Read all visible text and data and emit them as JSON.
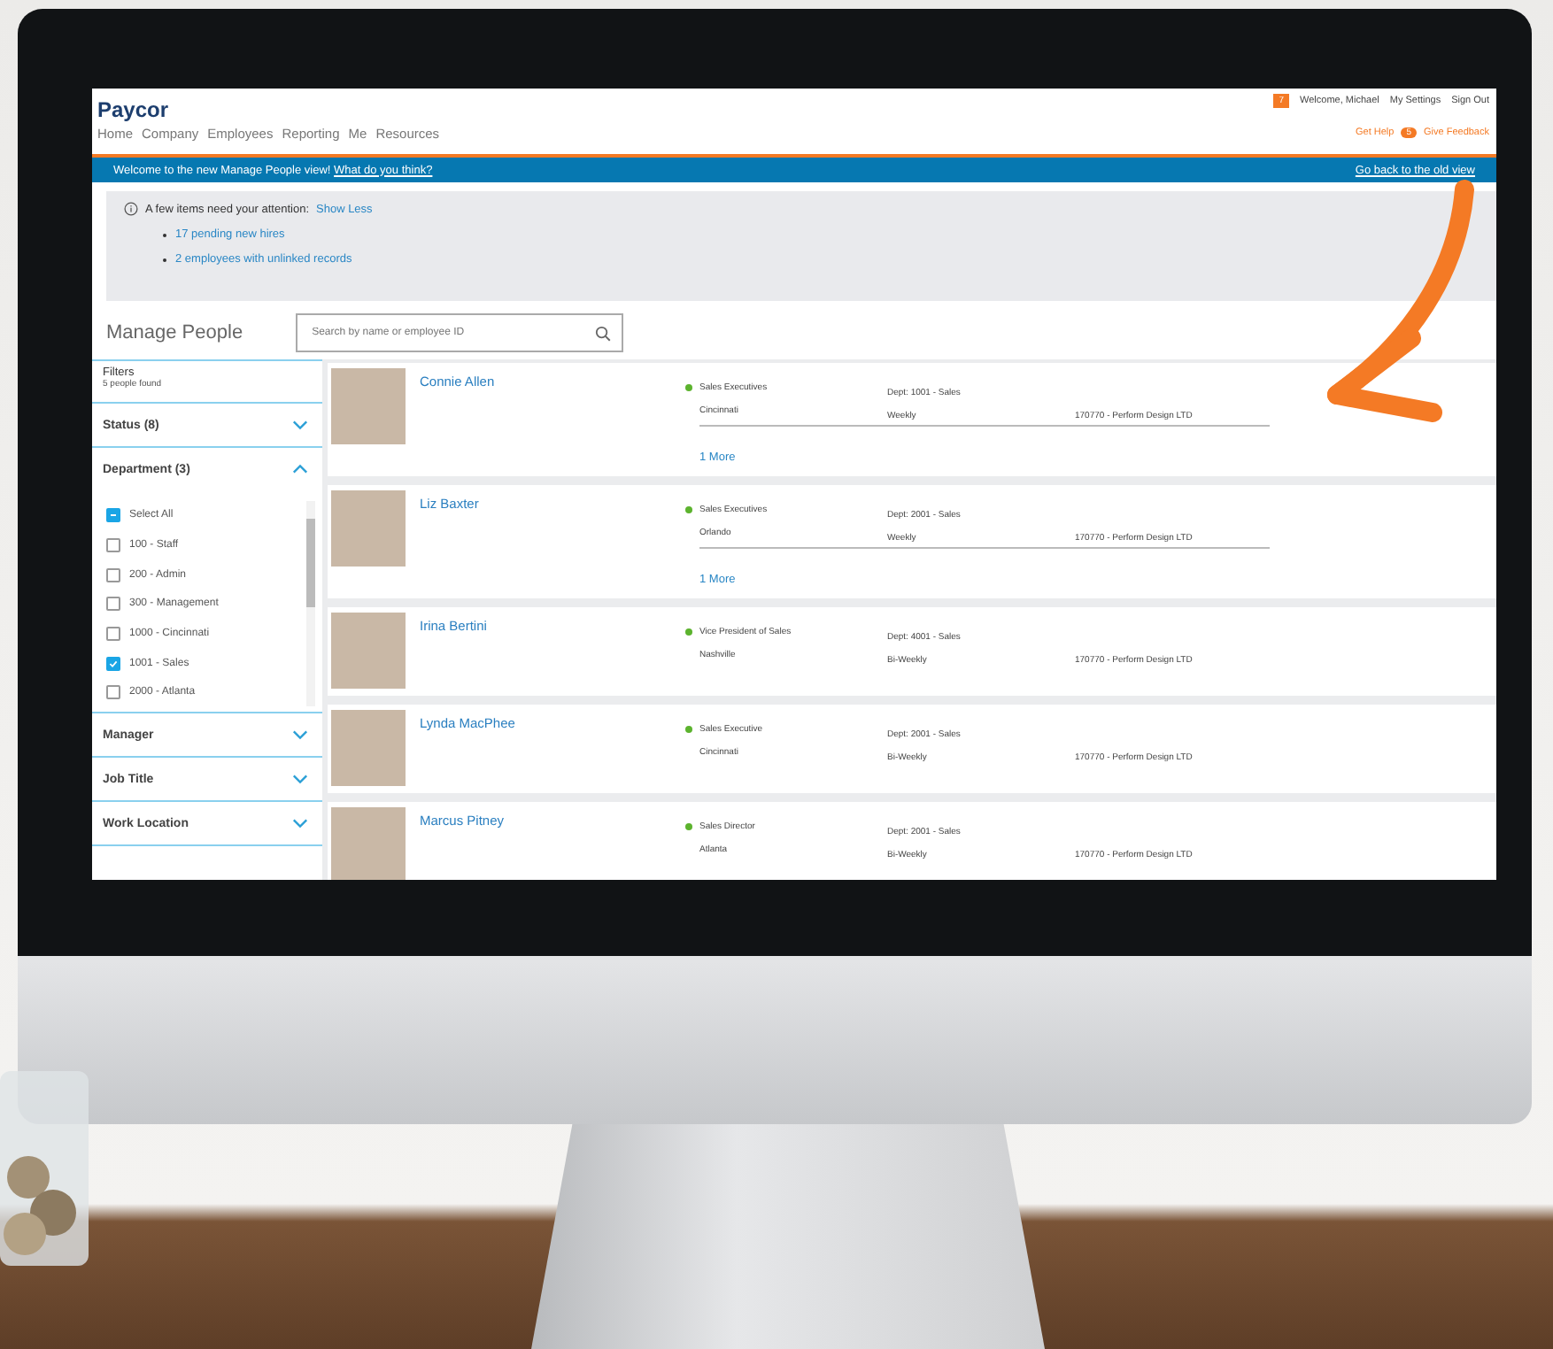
{
  "app": {
    "logo": "Paycor",
    "nav": [
      "Home",
      "Company",
      "Employees",
      "Reporting",
      "Me",
      "Resources"
    ],
    "notification_count": "7",
    "welcome": "Welcome, Michael",
    "settings": "My Settings",
    "sign_out": "Sign Out",
    "help": "Get Help",
    "help_count": "5",
    "feedback": "Give Feedback"
  },
  "banner": {
    "text": "Welcome to the new Manage People view!",
    "link": "What do you think?",
    "back_link": "Go back to the old view"
  },
  "attention": {
    "text": "A few items need your attention:",
    "toggle": "Show Less",
    "items": [
      "17 pending new hires",
      "2 employees with unlinked records"
    ]
  },
  "page_title": "Manage People",
  "search": {
    "placeholder": "Search by name or employee ID"
  },
  "filters": {
    "title": "Filters",
    "count": "5 people found",
    "sections": [
      {
        "label": "Status (8)",
        "expanded": false
      },
      {
        "label": "Department (3)",
        "expanded": true,
        "options": [
          {
            "label": "100 - Staff",
            "checked": false
          },
          {
            "label": "200 - Admin",
            "checked": false
          },
          {
            "label": "300 - Management",
            "checked": false
          },
          {
            "label": "1000 - Cincinnati",
            "checked": false
          },
          {
            "label": "1001 - Sales",
            "checked": true
          },
          {
            "label": "2000 - Atlanta",
            "checked": false
          }
        ],
        "select_all": {
          "label": "Select All",
          "partial": true
        }
      },
      {
        "label": "Manager",
        "expanded": false
      },
      {
        "label": "Job Title",
        "expanded": false
      },
      {
        "label": "Work Location",
        "expanded": false
      }
    ]
  },
  "people": [
    {
      "name": "Connie Allen",
      "title": "Sales Executives",
      "location": "Cincinnati",
      "dept": "Dept: 1001 - Sales",
      "pay": "Weekly",
      "company": "170770 - Perform Design LTD",
      "more": "1 More"
    },
    {
      "name": "Liz Baxter",
      "title": "Sales Executives",
      "location": "Orlando",
      "dept": "Dept: 2001 - Sales",
      "pay": "Weekly",
      "company": "170770 - Perform Design LTD",
      "more": "1 More"
    },
    {
      "name": "Irina Bertini",
      "title": "Vice President of Sales",
      "location": "Nashville",
      "dept": "Dept: 4001 - Sales",
      "pay": "Bi-Weekly",
      "company": "170770 - Perform Design LTD"
    },
    {
      "name": "Lynda MacPhee",
      "title": "Sales Executive",
      "location": "Cincinnati",
      "dept": "Dept: 2001 - Sales",
      "pay": "Bi-Weekly",
      "company": "170770 - Perform Design LTD"
    },
    {
      "name": "Marcus Pitney",
      "title": "Sales Director",
      "location": "Atlanta",
      "dept": "Dept: 2001 - Sales",
      "pay": "Bi-Weekly",
      "company": "170770 - Perform Design LTD"
    }
  ]
}
